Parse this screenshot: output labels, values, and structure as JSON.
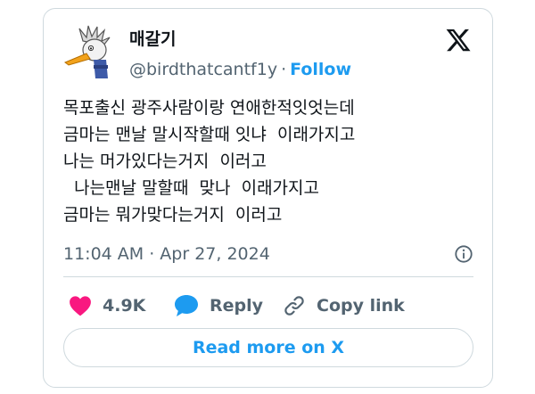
{
  "author": {
    "display_name": "매갈기",
    "handle": "@birdthatcantf1y",
    "separator": "·",
    "follow_label": "Follow"
  },
  "tweet": {
    "lines": [
      "목포출신 광주사람이랑 연애한적잇엇는데",
      "금마는 맨날 말시작할때 잇냐  이래가지고",
      "나는 머가있다는거지  이러고",
      "  나는맨날 말할때  맞나  이래가지고",
      "금마는 뭐가맞다는거지  이러고"
    ],
    "timestamp": "11:04 AM · Apr 27, 2024"
  },
  "actions": {
    "like_count": "4.9K",
    "reply_label": "Reply",
    "copy_label": "Copy link"
  },
  "read_more_label": "Read more on X",
  "colors": {
    "accent": "#1d9bf0",
    "like": "#f91880",
    "text": "#0f1419",
    "muted": "#536471",
    "border": "#cfd9de"
  },
  "icons": {
    "brand": "x-logo-icon",
    "info": "info-icon",
    "like": "heart-icon",
    "reply": "speech-bubble-icon",
    "copy": "link-icon"
  }
}
